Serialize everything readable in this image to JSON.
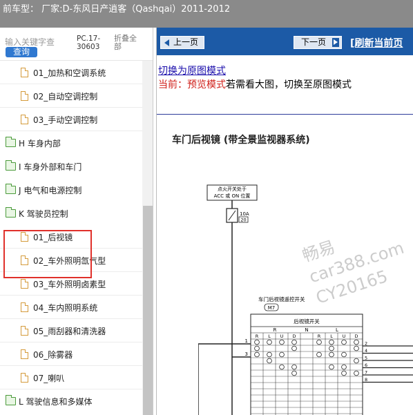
{
  "titlebar": {
    "text": "前车型：  厂家:D-东风日产逍客（Qashqai）2011-2012"
  },
  "sidebar": {
    "search_placeholder": "输入关键字查",
    "query_label": "查询",
    "pc_code": "PC.17-30603",
    "collapse_all": "折叠全部",
    "tree": [
      {
        "type": "child",
        "label": "01_加热和空调系统"
      },
      {
        "type": "child",
        "label": "02_自动空调控制"
      },
      {
        "type": "child",
        "label": "03_手动空调控制"
      },
      {
        "type": "folder",
        "label": "H 车身内部"
      },
      {
        "type": "folder",
        "label": "I 车身外部和车门"
      },
      {
        "type": "folder",
        "label": "J 电气和电源控制"
      },
      {
        "type": "folder",
        "label": "K 驾驶员控制"
      },
      {
        "type": "child",
        "label": "01_后视镜"
      },
      {
        "type": "child",
        "label": "02_车外照明氙气型"
      },
      {
        "type": "child",
        "label": "03_车外照明卤素型"
      },
      {
        "type": "child",
        "label": "04_车内照明系统"
      },
      {
        "type": "child",
        "label": "05_雨刮器和清洗器"
      },
      {
        "type": "child",
        "label": "06_除雾器"
      },
      {
        "type": "child",
        "label": "07_喇叭"
      },
      {
        "type": "folder",
        "label": "L 驾驶信息和多媒体"
      }
    ]
  },
  "content": {
    "prev_label": "上一页",
    "next_label": "下一页",
    "refresh_label": "[刷新当前页",
    "switch_link": "切换为原图模式",
    "mode_prefix": "当前：",
    "mode_current": "预览模式",
    "mode_suffix": "若需看大图，切换至原图模式",
    "doc_title": "车门后视镜 (带全景监视器系统)",
    "diagram": {
      "ignition_label_1": "点火开关处于",
      "ignition_label_2": "ACC 或 ON 位置",
      "fuse_amp": "10A",
      "fuse_no": "20",
      "switch_title": "车门后视镜遥控开关",
      "connector": "M7",
      "switch_name": "后视镜开关",
      "col_R": "R",
      "col_N": "N",
      "col_L": "L",
      "sub_cols": [
        "R",
        "L",
        "U",
        "D",
        "",
        "R",
        "L",
        "U",
        "D"
      ],
      "pin_1": "1",
      "pin_3": "3",
      "right_pins": [
        "2",
        "4",
        "5",
        "6",
        "7",
        "8"
      ]
    },
    "watermark": [
      "畅易",
      "car388.com",
      "CY20165"
    ]
  }
}
